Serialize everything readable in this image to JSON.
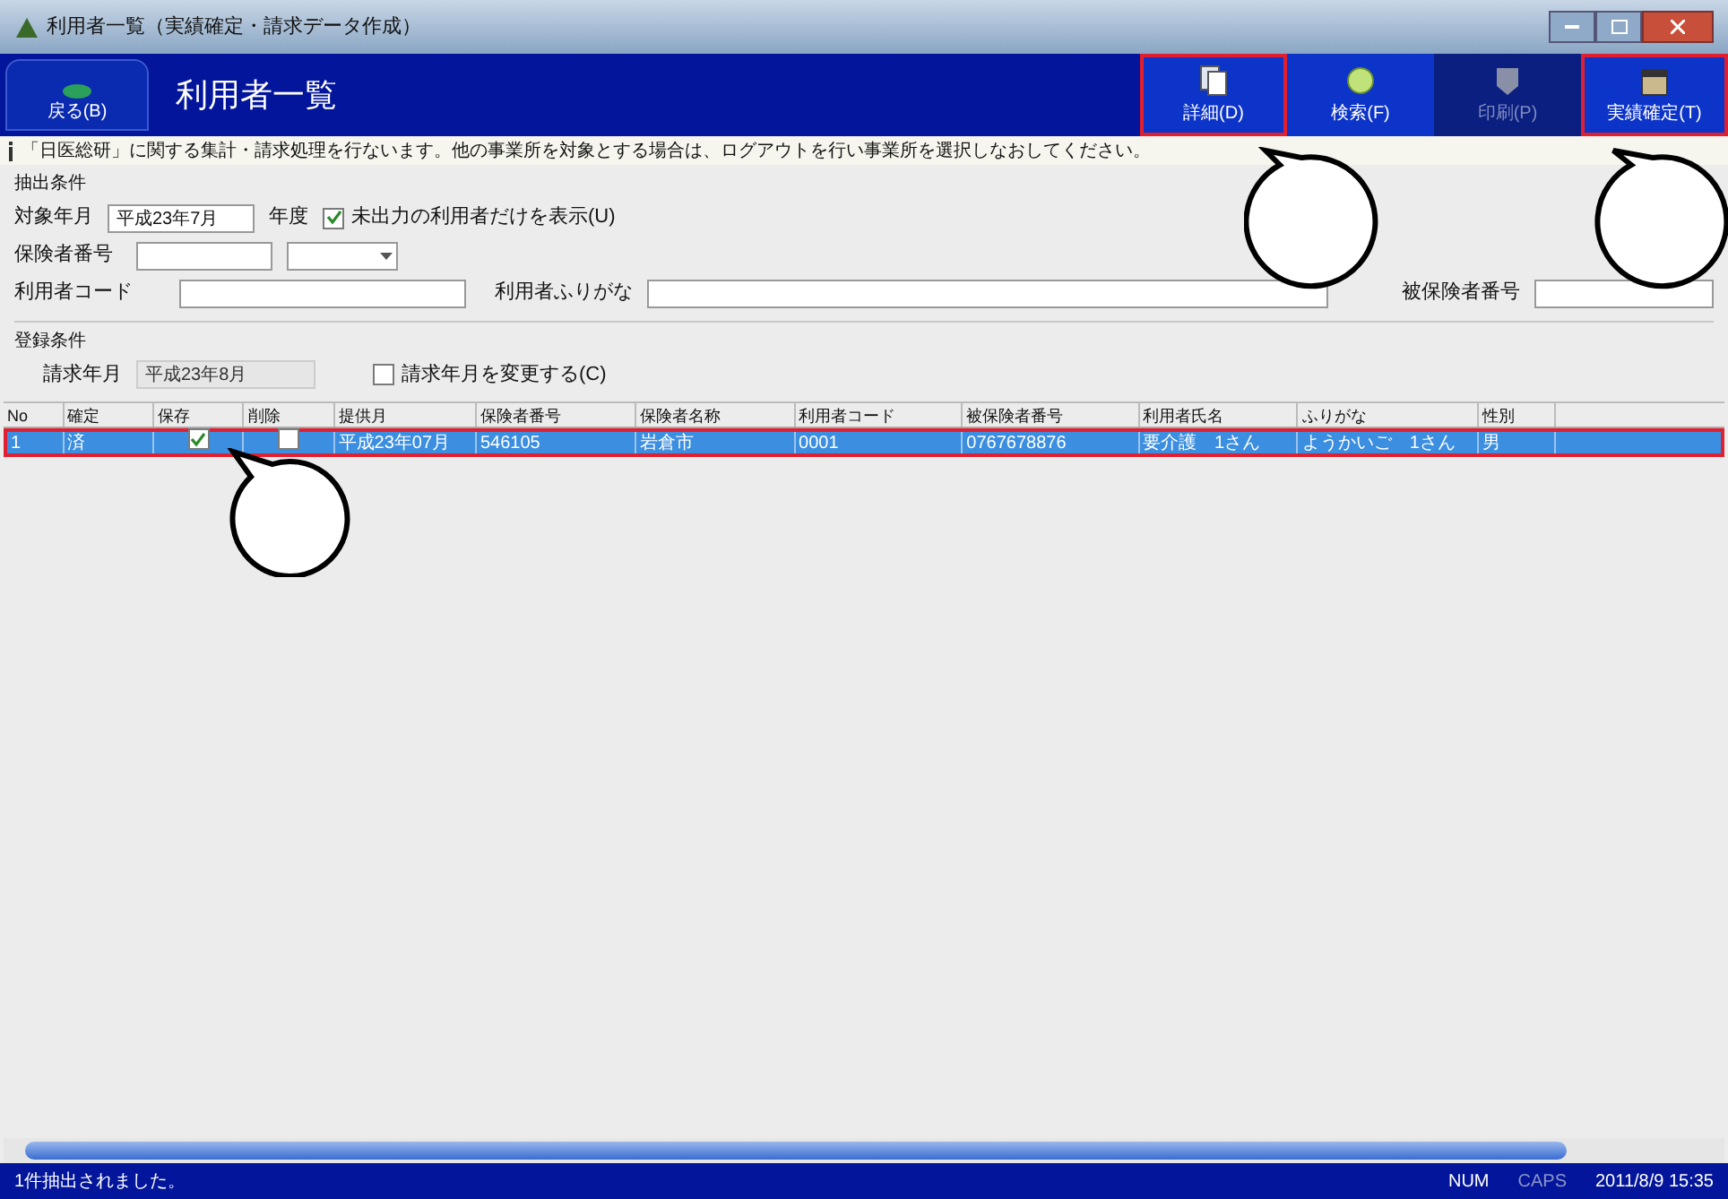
{
  "window": {
    "title": "利用者一覧（実績確定・請求データ作成）"
  },
  "header": {
    "back_button": "戻る(B)",
    "title": "利用者一覧"
  },
  "toolbar": [
    {
      "kind": "detail",
      "label": "詳細(D)",
      "disabled": false,
      "highlighted": true
    },
    {
      "kind": "search",
      "label": "検索(F)",
      "disabled": false,
      "highlighted": false
    },
    {
      "kind": "print",
      "label": "印刷(P)",
      "disabled": true,
      "highlighted": false
    },
    {
      "kind": "confirm",
      "label": "実績確定(T)",
      "disabled": false,
      "highlighted": true
    }
  ],
  "info": "「日医総研」に関する集計・請求処理を行ないます。他の事業所を対象とする場合は、ログアウトを行い事業所を選択しなおしてください。",
  "filter": {
    "title": "抽出条件",
    "month_label": "対象年月",
    "month_value": "平成23年7月",
    "year_label": "年度",
    "unprinted_only": {
      "label": "未出力の利用者だけを表示(U)",
      "checked": true
    },
    "insurer_label": "保険者番号",
    "user_code_label": "利用者コード",
    "kana_label": "利用者ふりがな",
    "insured_label": "被保険者番号"
  },
  "registration": {
    "title": "登録条件",
    "billing_label": "請求年月",
    "billing_value": "平成23年8月",
    "change": {
      "label": "請求年月を変更する(C)",
      "checked": false
    }
  },
  "table": {
    "columns": [
      "No",
      "確定",
      "保存",
      "削除",
      "提供月",
      "保険者番号",
      "保険者名称",
      "利用者コード",
      "被保険者番号",
      "利用者氏名",
      "ふりがな",
      "性別"
    ],
    "rows": [
      {
        "selected": true,
        "no": "1",
        "confirmed": "済",
        "save": true,
        "delete": false,
        "month": "平成23年07月",
        "insurer_no": "546105",
        "insurer_name": "岩倉市",
        "user_code": "0001",
        "insured_no": "0767678876",
        "name": "要介護　1さん",
        "kana": "ようかいご　1さん",
        "sex": "男"
      }
    ]
  },
  "status_bar": {
    "message": "1件抽出されました。",
    "num": "NUM",
    "caps": "CAPS",
    "datetime": "2011/8/9 15:35"
  }
}
